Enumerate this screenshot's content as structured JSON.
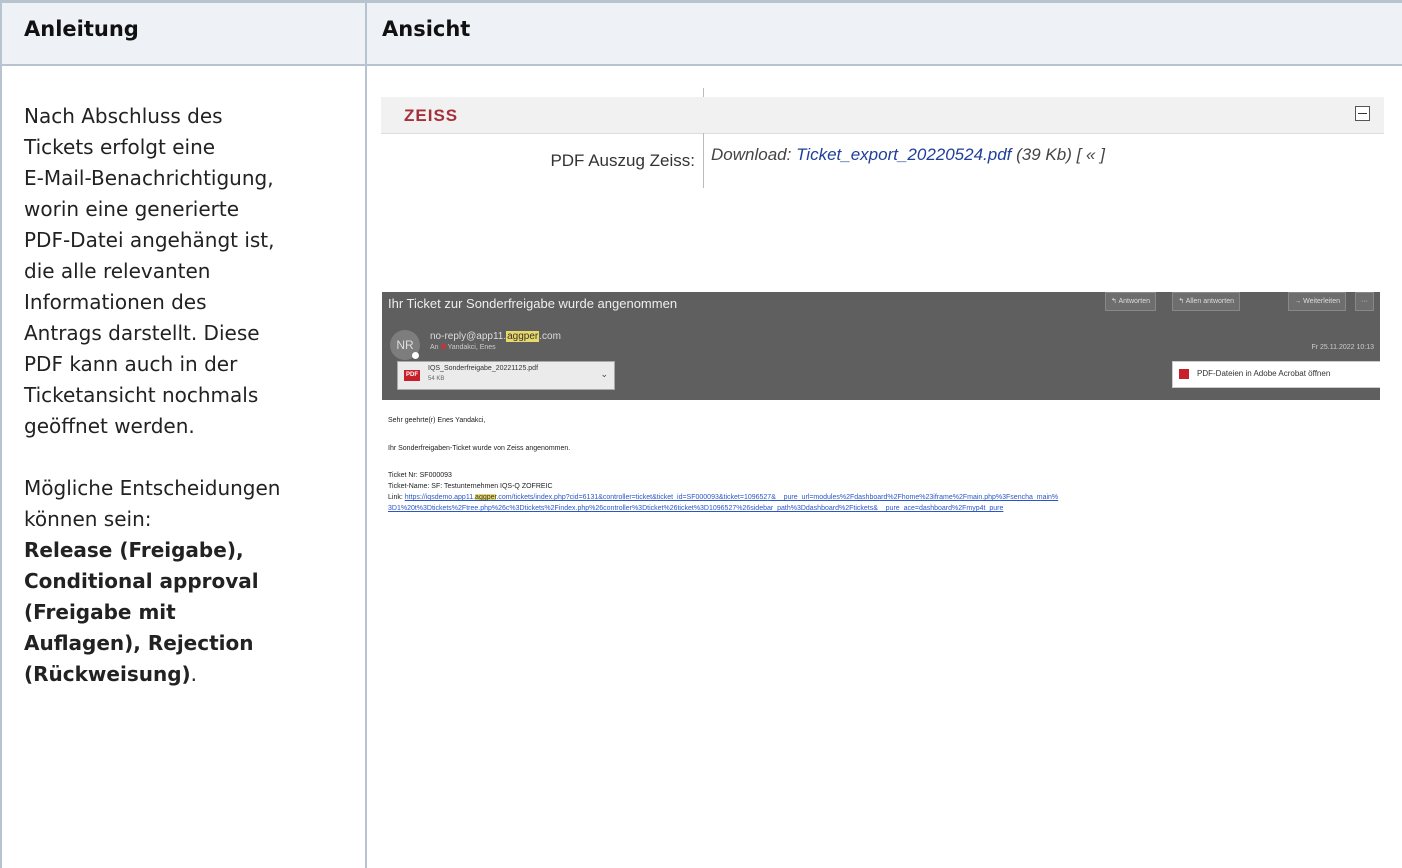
{
  "table": {
    "col_left_header": "Anleitung",
    "col_right_header": "Ansicht"
  },
  "instructions": {
    "p1_lines": [
      "Nach Abschluss des",
      "Tickets erfolgt eine",
      "E-Mail-Benachrichtigung,",
      "worin eine generierte",
      "PDF-Datei angehängt ist,",
      "die alle relevanten",
      "Informationen des",
      "Antrags darstellt. Diese",
      "PDF kann auch in der",
      "Ticketansicht nochmals",
      "geöffnet werden."
    ],
    "p2_lines": [
      "Mögliche Entscheidungen",
      "können sein:"
    ],
    "p2_bold_lines": [
      "Release (Freigabe),",
      "Conditional approval",
      "(Freigabe mit",
      "Auflagen), Rejection",
      "(Rückweisung)"
    ],
    "p2_end": "."
  },
  "zeiss_panel": {
    "title": "ZEISS",
    "pdf_label": "PDF Auszug Zeiss:",
    "download_prefix": "Download: ",
    "file_name": "Ticket_export_20220524.pdf",
    "file_size": " (39 Kb) [ « ]"
  },
  "email": {
    "subject": "Ihr Ticket zur Sonderfreigabe wurde angenommen",
    "avatar_initials": "NR",
    "sender_prefix": "no-reply@app11.",
    "sender_highlight": "aggper",
    "sender_suffix": ".com",
    "recipient_prefix": "An",
    "recipient_name": "Yandakci, Enes",
    "buttons": {
      "reply": "↰ Antworten",
      "reply_all": "↰ Allen antworten",
      "forward": "→ Weiterleiten",
      "more": "···"
    },
    "date": "Fr 25.11.2022 10:13",
    "attachment_name": "IQS_Sonderfreigabe_20221125.pdf",
    "attachment_size": "54 KB",
    "acrobat_label": "PDF-Dateien in Adobe Acrobat öffnen",
    "greeting": "Sehr geehrte(r) Enes Yandakci,",
    "message": "Ihr Sonderfreigaben-Ticket wurde von Zeiss angenommen.",
    "ticket_nr": "Ticket Nr: SF000093",
    "ticket_name": "Ticket-Name: SF: Testunternehmen IQS-Q ZOFREIC",
    "link_label": "Link: ",
    "link_part1": "https://iqsdemo.app11.",
    "link_highlight": "aggper",
    "link_part2": ".com/tickets/index.php?cid=6131&controller=ticket&ticket_id=SF000093&ticket=1096527&__pure_url=modules%2Fdashboard%2Fhome%23iframe%2Fmain.php%3Fsencha_main%",
    "link_line2": "3D1%20t%3Dtickets%2Ftree.php%26c%3Dtickets%2Findex.php%26controller%3Dticket%26ticket%3D1096527%26sidebar_path%3Ddashboard%2Ftickets&__pure_ace=dashboard%2Fmyp4t_pure"
  }
}
